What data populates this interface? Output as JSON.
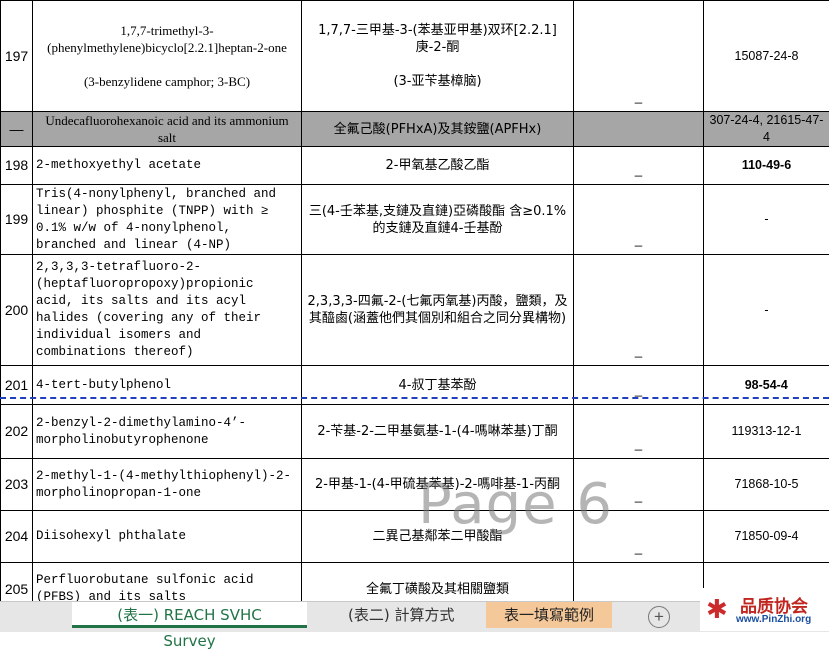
{
  "rows": [
    {
      "num": "197",
      "en": "1,7,7-trimethyl-3-(phenylmethylene)bicyclo[2.2.1]heptan-2-one\n\n(3-benzylidene camphor; 3-BC)",
      "zh": "1,7,7-三甲基-3-(苯基亚甲基)双环[2.2.1]庚-2-酮\n\n(3-亚苄基樟脑)",
      "dash": "_",
      "cas": "15087-24-8"
    },
    {
      "num": "—",
      "en": "Undecafluorohexanoic acid and its ammonium salt",
      "zh": "全氟己酸(PFHxA)及其銨鹽(APFHx)",
      "dash": "",
      "cas": "307-24-4, 21615-47-4"
    },
    {
      "num": "198",
      "en": "2-methoxyethyl acetate",
      "zh": "2-甲氧基乙酸乙酯",
      "dash": "_",
      "cas": "110-49-6"
    },
    {
      "num": "199",
      "en": "Tris(4-nonylphenyl, branched and linear) phosphite (TNPP) with ≥ 0.1% w/w of 4-nonylphenol, branched and linear (4-NP)",
      "zh": "三(4-壬苯基,支鏈及直鏈)亞磷酸酯 含≥0.1%的支鏈及直鏈4-壬基酚",
      "dash": "_",
      "cas": "-"
    },
    {
      "num": "200",
      "en": "2,3,3,3-tetrafluoro-2-(heptafluoropropoxy)propionic acid, its salts and its acyl halides (covering any of their individual isomers and combinations thereof)",
      "zh": "2,3,3,3-四氟-2-(七氟丙氧基)丙酸，鹽類，及其醯鹵(涵蓋他們其個別和組合之同分異構物)",
      "dash": "_",
      "cas": "-"
    },
    {
      "num": "201",
      "en": "4-tert-butylphenol",
      "zh": "4-叔丁基苯酚",
      "dash": "_",
      "cas": "98-54-4"
    },
    {
      "num": "202",
      "en": "2-benzyl-2-dimethylamino-4’-morpholinobutyrophenone",
      "zh": "2-苄基-2-二甲基氨基-1-(4-嗎啉苯基)丁酮",
      "dash": "_",
      "cas": "119313-12-1"
    },
    {
      "num": "203",
      "en": "2-methyl-1-(4-methylthiophenyl)-2-morpholinopropan-1-one",
      "zh": "2-甲基-1-(4-甲硫基苯基)-2-嗎啡基-1-丙酮",
      "dash": "_",
      "cas": "71868-10-5"
    },
    {
      "num": "204",
      "en": "Diisohexyl phthalate",
      "zh": "二異己基鄰苯二甲酸酯",
      "dash": "_",
      "cas": "71850-09-4"
    },
    {
      "num": "205",
      "en": "Perfluorobutane sulfonic acid (PFBS) and its salts",
      "zh": "全氟丁磺酸及其相關鹽類",
      "dash": "_",
      "cas": ""
    }
  ],
  "watermark": "Page 6",
  "tabs": {
    "tab1": "(表一) REACH SVHC Survey",
    "tab2": "(表二) 計算方式",
    "tab3": "表一填寫範例",
    "add": "+"
  },
  "logo": {
    "title": "品质协会",
    "url": "www.PinZhi.org"
  }
}
